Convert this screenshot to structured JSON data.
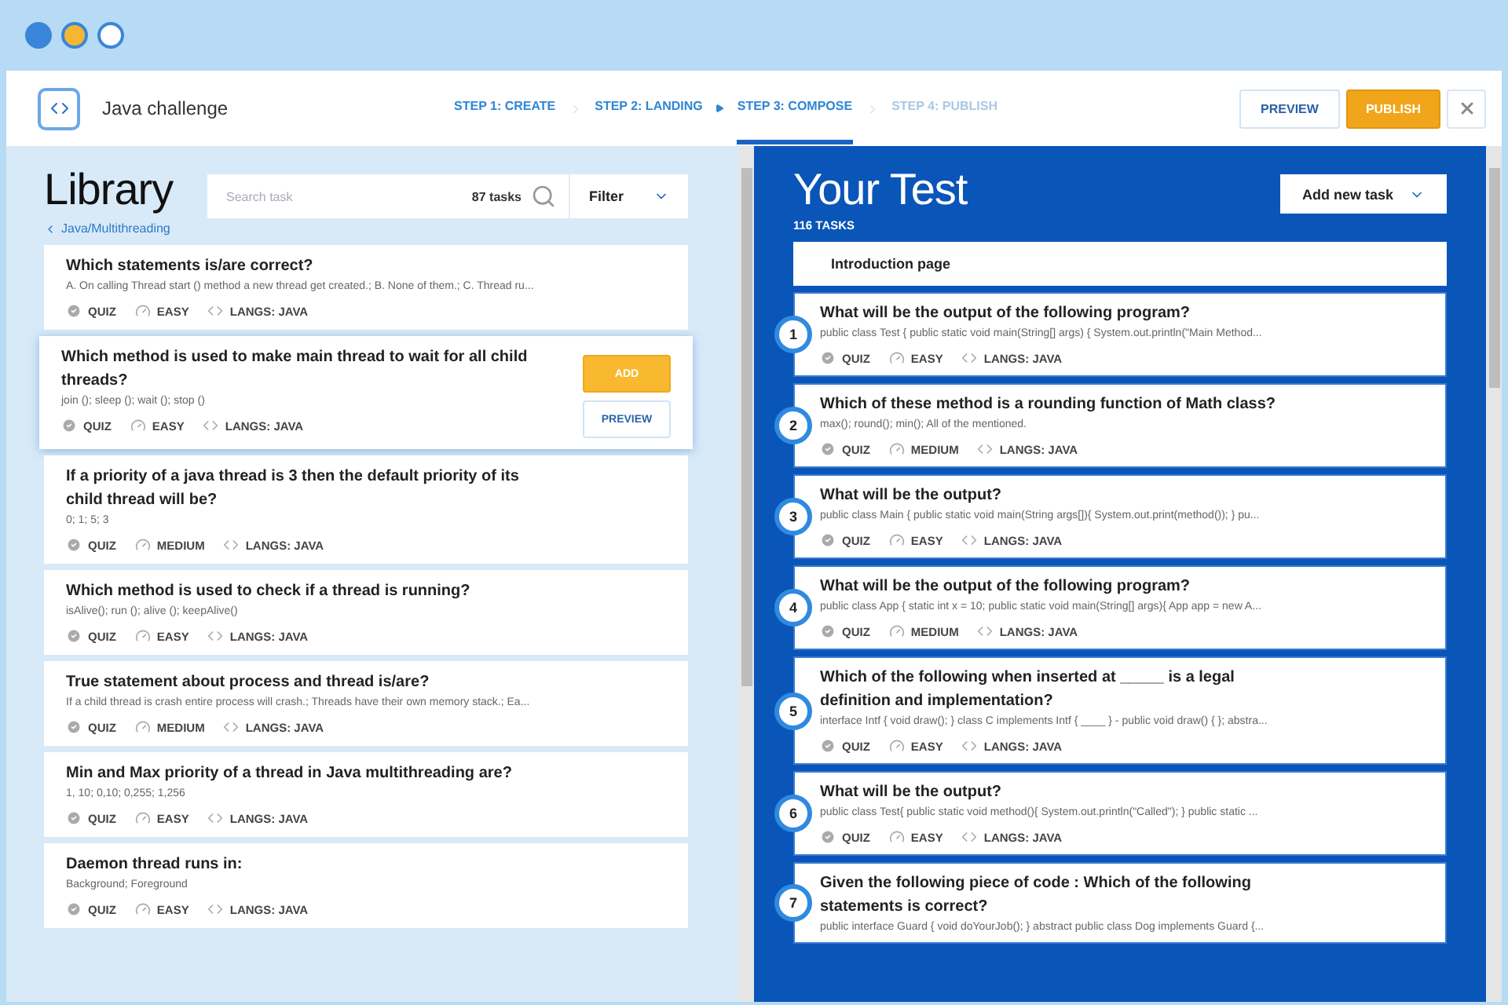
{
  "header": {
    "title": "Java challenge",
    "steps": [
      {
        "label": "STEP 1: CREATE",
        "selected": false,
        "disabled": false
      },
      {
        "label": "STEP 2: LANDING",
        "selected": false,
        "disabled": false
      },
      {
        "label": "STEP 3: COMPOSE",
        "selected": true,
        "disabled": false
      },
      {
        "label": "STEP 4: PUBLISH",
        "selected": false,
        "disabled": true
      }
    ],
    "buttons": [
      {
        "kind": "outline",
        "label": "PREVIEW"
      },
      {
        "kind": "primary",
        "label": "PUBLISH"
      },
      {
        "kind": "close"
      }
    ]
  },
  "library": {
    "title": "Library",
    "search": {
      "placeholder": "Search task",
      "count": "87 tasks"
    },
    "filter": "Filter",
    "breadcrumb": "Java/Multithreading",
    "tasks": [
      {
        "title": "Which statements is/are correct?",
        "answers": "A. On calling Thread start () method a new thread get created.; B. None of them.; C. Thread ru...",
        "type": "QUIZ",
        "difficulty": "EASY",
        "langs": "LANGS: JAVA",
        "hovered": false
      },
      {
        "title": "Which method is used to make main thread to wait for all child threads?",
        "answers": "join (); sleep (); wait (); stop ()",
        "type": "QUIZ",
        "difficulty": "EASY",
        "langs": "LANGS: JAVA",
        "hovered": true,
        "actions": [
          "ADD",
          "PREVIEW"
        ]
      },
      {
        "title": "If a priority of a java thread is 3 then the default priority of its child thread will be?",
        "answers": "0; 1; 5; 3",
        "type": "QUIZ",
        "difficulty": "MEDIUM",
        "langs": "LANGS: JAVA",
        "hovered": false
      },
      {
        "title": "Which method is used to check if a thread is running?",
        "answers": "isAlive(); run (); alive (); keepAlive()",
        "type": "QUIZ",
        "difficulty": "EASY",
        "langs": "LANGS: JAVA",
        "hovered": false
      },
      {
        "title": "True statement about process and thread is/are?",
        "answers": "If a child thread is crash entire process will crash.; Threads have their own memory stack.; Ea...",
        "type": "QUIZ",
        "difficulty": "MEDIUM",
        "langs": "LANGS: JAVA",
        "hovered": false
      },
      {
        "title": "Min and Max priority of a thread in Java multithreading are?",
        "answers": "1, 10; 0,10; 0,255; 1,256",
        "type": "QUIZ",
        "difficulty": "EASY",
        "langs": "LANGS: JAVA",
        "hovered": false
      },
      {
        "title": "Daemon thread runs in:",
        "answers": "Background; Foreground",
        "type": "QUIZ",
        "difficulty": "EASY",
        "langs": "LANGS: JAVA",
        "hovered": false
      }
    ]
  },
  "test": {
    "title": "Your Test",
    "count": "116 TASKS",
    "add_button": "Add new task",
    "intro": "Introduction page",
    "tasks": [
      {
        "number": "1",
        "title": "What will be the output of the following program?",
        "answers": "public class Test { public static void main(String[] args) { System.out.println(\"Main Method...",
        "type": "QUIZ",
        "difficulty": "EASY",
        "langs": "LANGS: JAVA"
      },
      {
        "number": "2",
        "title": "Which of these method is a rounding function of Math class?",
        "answers": "max(); round(); min(); All of the mentioned.",
        "type": "QUIZ",
        "difficulty": "MEDIUM",
        "langs": "LANGS: JAVA"
      },
      {
        "number": "3",
        "title": "What will be the output?",
        "answers": "public class Main { public static void main(String args[]){ System.out.print(method()); } pu...",
        "type": "QUIZ",
        "difficulty": "EASY",
        "langs": "LANGS: JAVA"
      },
      {
        "number": "4",
        "title": "What will be the output of the following program?",
        "answers": "public class App { static int x = 10; public static void main(String[] args){ App app = new A...",
        "type": "QUIZ",
        "difficulty": "MEDIUM",
        "langs": "LANGS: JAVA"
      },
      {
        "number": "5",
        "title": "Which of the following when inserted at _____ is a legal definition and implementation?",
        "answers": "interface Intf { void draw(); } class C implements Intf { ____ } - public void draw() { }; abstra...",
        "type": "QUIZ",
        "difficulty": "EASY",
        "langs": "LANGS: JAVA"
      },
      {
        "number": "6",
        "title": "What will be the output?",
        "answers": "public class Test{ public static void method(){ System.out.println(\"Called\"); } public static ...",
        "type": "QUIZ",
        "difficulty": "EASY",
        "langs": "LANGS: JAVA"
      },
      {
        "number": "7",
        "title": "Given the following piece of code : Which of the following statements is correct?",
        "answers": "public interface Guard { void doYourJob(); } abstract public class Dog implements Guard {..."
      }
    ]
  }
}
